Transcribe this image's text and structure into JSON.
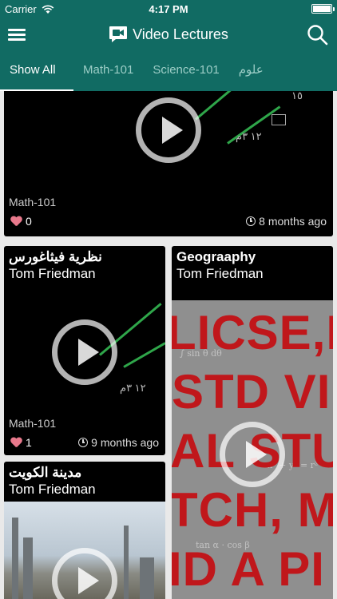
{
  "status_bar": {
    "carrier": "Carrier",
    "time": "4:17 PM"
  },
  "nav": {
    "title": "Video Lectures",
    "icons": [
      "menu-icon",
      "video-icon",
      "search-icon"
    ]
  },
  "tabs": [
    {
      "label": "Show All",
      "active": true
    },
    {
      "label": "Math-101",
      "active": false
    },
    {
      "label": "Science-101",
      "active": false
    },
    {
      "label": "علوم",
      "active": false
    }
  ],
  "cards": [
    {
      "title": "",
      "author": "",
      "category": "Math-101",
      "likes": "0",
      "time": "8 months ago"
    },
    {
      "title": "نظرية فيثاغورس",
      "author": "Tom Friedman",
      "category": "Math-101",
      "likes": "1",
      "time": "9 months ago"
    },
    {
      "title": "Geograaphy",
      "author": "Tom Friedman",
      "category": "",
      "likes": "",
      "time": ""
    },
    {
      "title": "مدينة الكويت",
      "author": "Tom Friedman",
      "category": "",
      "likes": "",
      "time": ""
    }
  ],
  "thumb_text": {
    "chalk_a": "١٥",
    "chalk_b": "١٢ ٣م",
    "chalk_c": "١٢ ٣م",
    "big_red_lines": [
      "LICSE,N",
      "STD VI",
      "AL STU",
      "TCH, M",
      "ID A PI"
    ]
  },
  "colors": {
    "primary": "#116b63",
    "accent_heart": "#e8798c"
  }
}
